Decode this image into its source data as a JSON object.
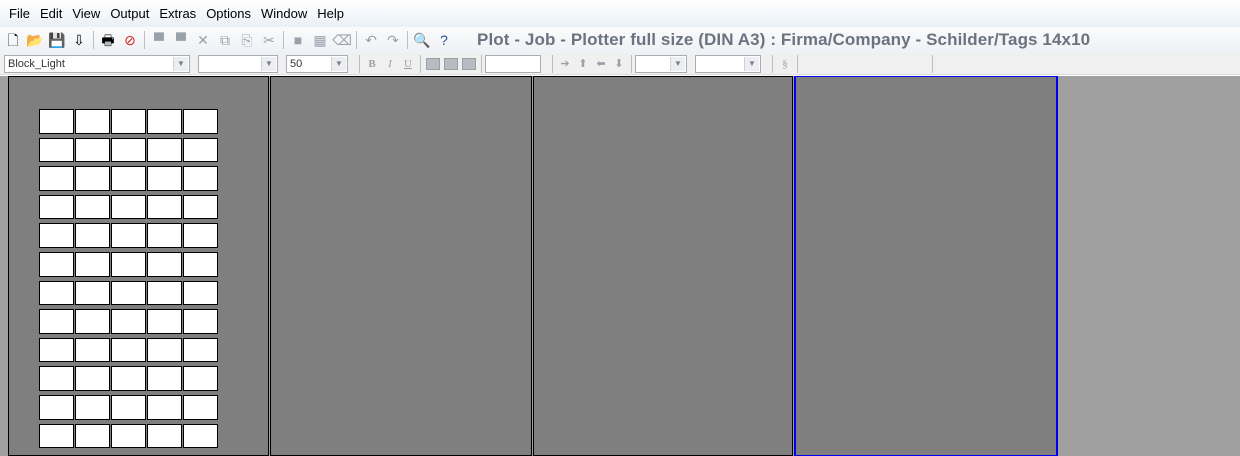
{
  "menu": [
    "File",
    "Edit",
    "View",
    "Output",
    "Extras",
    "Options",
    "Window",
    "Help"
  ],
  "toolbar": {
    "buttons": [
      {
        "name": "new-icon",
        "glyph": "🗋"
      },
      {
        "name": "open-folder-icon",
        "glyph": "📂"
      },
      {
        "name": "save-icon",
        "glyph": "💾"
      },
      {
        "name": "import-icon",
        "glyph": "⇩"
      },
      {
        "name": "sep"
      },
      {
        "name": "print-icon",
        "glyph": "🖶"
      },
      {
        "name": "stop-icon",
        "glyph": "⊘"
      },
      {
        "name": "sep"
      },
      {
        "name": "new-tag-icon",
        "glyph": "▀"
      },
      {
        "name": "edit-tag-icon",
        "glyph": "▀"
      },
      {
        "name": "delete-icon",
        "glyph": "✕"
      },
      {
        "name": "copy-icon",
        "glyph": "⧉"
      },
      {
        "name": "paste-icon",
        "glyph": "⎘"
      },
      {
        "name": "cut-icon",
        "glyph": "✂"
      },
      {
        "name": "sep"
      },
      {
        "name": "fill-icon",
        "glyph": "■"
      },
      {
        "name": "layout-icon",
        "glyph": "▦"
      },
      {
        "name": "clear-icon",
        "glyph": "⌫"
      },
      {
        "name": "sep"
      },
      {
        "name": "undo-icon",
        "glyph": "↶"
      },
      {
        "name": "redo-icon",
        "glyph": "↷"
      },
      {
        "name": "sep"
      },
      {
        "name": "zoom-icon",
        "glyph": "🔍"
      },
      {
        "name": "help-icon",
        "glyph": "?"
      }
    ],
    "job_title": "Plot - Job - Plotter full size (DIN A3)   :   Firma/Company - Schilder/Tags 14x10"
  },
  "format_bar": {
    "font_value": "Block_Light",
    "style_value": "",
    "size_value": "50",
    "bold_label": "B",
    "italic_label": "I",
    "underline_label": "U"
  },
  "panels": {
    "count": 4,
    "selected_index": 3,
    "grid_rows": 12,
    "grid_cols": 5
  },
  "colors": {
    "workspace": "#a0a0a0",
    "panel": "#7f7f7f",
    "selected_border": "#0000ee",
    "title_text": "#6c7380"
  }
}
